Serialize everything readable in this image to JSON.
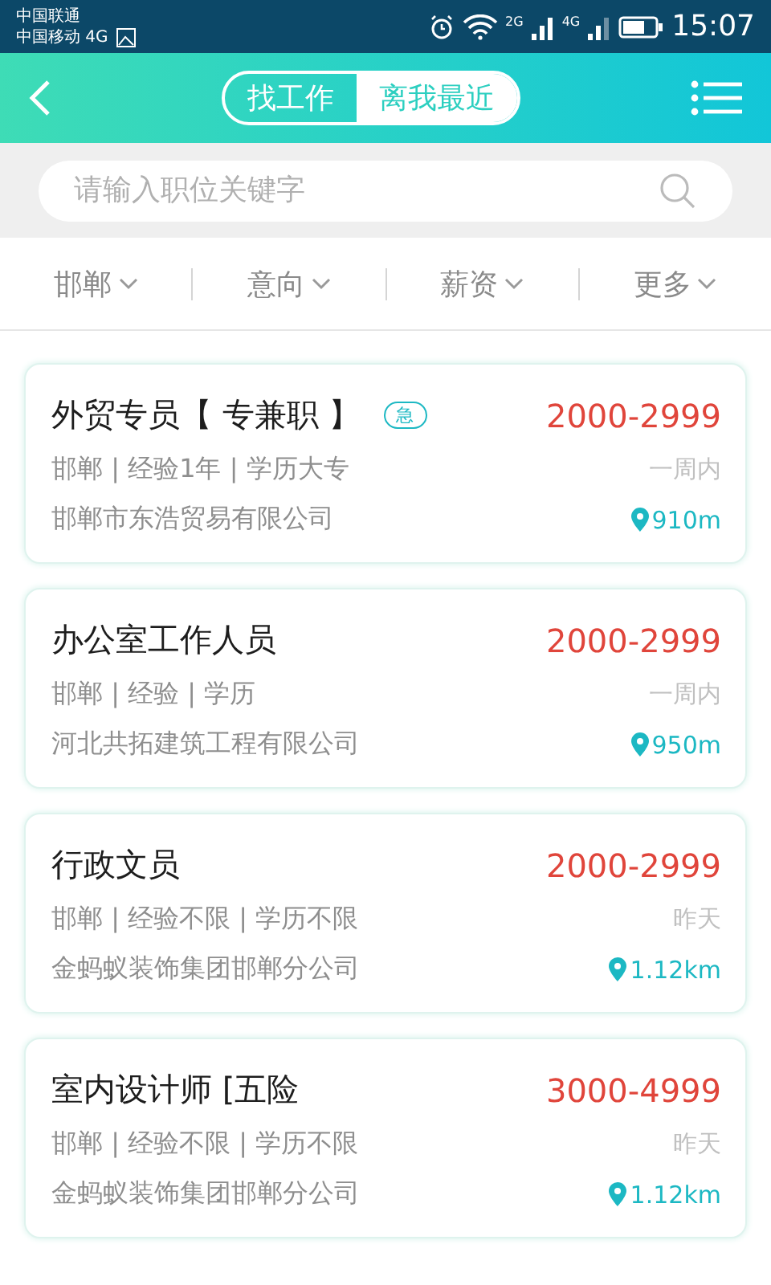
{
  "status_bar": {
    "carrier_1": "中国联通",
    "carrier_2": "中国移动 4G",
    "network_1": "2G",
    "network_2": "4G",
    "time": "15:07"
  },
  "header": {
    "tabs": [
      {
        "label": "找工作",
        "selected": false
      },
      {
        "label": "离我最近",
        "selected": true
      }
    ]
  },
  "search": {
    "placeholder": "请输入职位关键字"
  },
  "filters": [
    "邯郸",
    "意向",
    "薪资",
    "更多"
  ],
  "jobs": [
    {
      "title": "外贸专员【 专兼职 】",
      "urgent": true,
      "urgent_label": "急",
      "salary": "2000-2999",
      "details": "邯郸 | 经验1年 | 学历大专",
      "posted": "一周内",
      "company": "邯郸市东浩贸易有限公司",
      "distance": "910m"
    },
    {
      "title": "办公室工作人员",
      "urgent": false,
      "salary": "2000-2999",
      "details": "邯郸 | 经验 | 学历",
      "posted": "一周内",
      "company": "河北共拓建筑工程有限公司",
      "distance": "950m"
    },
    {
      "title": "行政文员",
      "urgent": false,
      "salary": "2000-2999",
      "details": "邯郸 | 经验不限 | 学历不限",
      "posted": "昨天",
      "company": "金蚂蚁装饰集团邯郸分公司",
      "distance": "1.12km"
    },
    {
      "title": "室内设计师 [五险",
      "urgent": false,
      "salary": "3000-4999",
      "details": "邯郸 | 经验不限 | 学历不限",
      "posted": "昨天",
      "company": "金蚂蚁装饰集团邯郸分公司",
      "distance": "1.12km"
    }
  ]
}
